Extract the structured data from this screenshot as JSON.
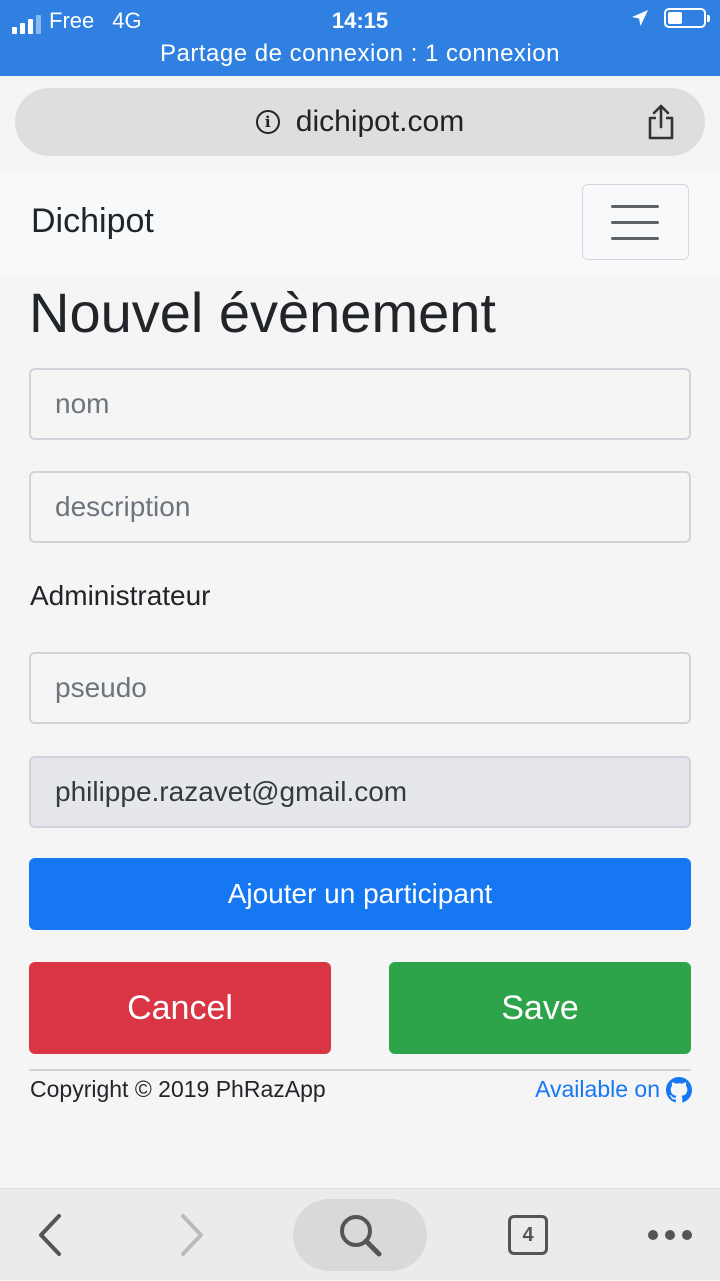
{
  "status_bar": {
    "carrier": "Free",
    "network": "4G",
    "time": "14:15",
    "hotspot_text": "Partage de connexion : 1 connexion",
    "icons": [
      "signal-icon",
      "location-arrow-icon",
      "battery-icon"
    ]
  },
  "browser": {
    "url": "dichipot.com",
    "tab_count": "4"
  },
  "navbar": {
    "brand": "Dichipot"
  },
  "form": {
    "title": "Nouvel évènement",
    "name_placeholder": "nom",
    "description_placeholder": "description",
    "admin_label": "Administrateur",
    "pseudo_placeholder": "pseudo",
    "email_value": "philippe.razavet@gmail.com",
    "add_participant_label": "Ajouter un participant",
    "cancel_label": "Cancel",
    "save_label": "Save"
  },
  "footer": {
    "copyright": "Copyright © 2019 PhRazApp",
    "available": "Available on"
  },
  "colors": {
    "status_bar": "#2f80e0",
    "primary": "#1677f2",
    "danger": "#d93545",
    "success": "#2ea44a"
  }
}
